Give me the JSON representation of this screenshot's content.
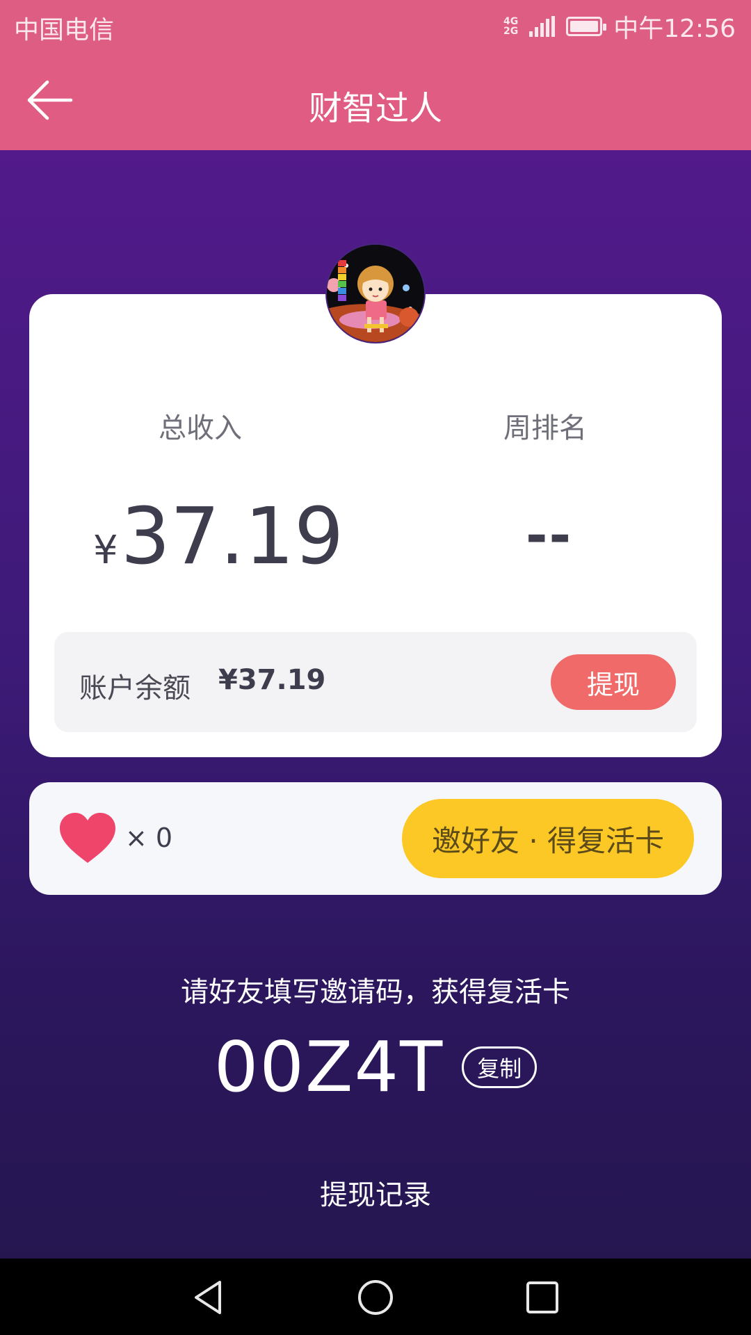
{
  "status_bar": {
    "carrier": "中国电信",
    "network_top": "4G",
    "network_bottom": "2G",
    "time": "中午12:56",
    "icons": [
      "signal-icon",
      "battery-icon"
    ]
  },
  "app_bar": {
    "title": "财智过人",
    "back_icon": "back-arrow-icon"
  },
  "stats": {
    "income_label": "总收入",
    "income_currency": "¥",
    "income_value": "37.19",
    "rank_label": "周排名",
    "rank_value": "--"
  },
  "balance": {
    "label": "账户余额",
    "value": "¥37.19",
    "withdraw_label": "提现"
  },
  "lives": {
    "icon": "heart-icon",
    "count_text": "× 0",
    "invite_button_label": "邀好友 · 得复活卡"
  },
  "invite": {
    "hint": "请好友填写邀请码，获得复活卡",
    "code": "00Z4T",
    "copy_label": "复制"
  },
  "records_link": "提现记录",
  "nav": {
    "icons": [
      "nav-back-icon",
      "nav-home-icon",
      "nav-recents-icon"
    ]
  },
  "colors": {
    "header": "#e05c82",
    "background_top": "#521a8a",
    "background_bottom": "#251650",
    "withdraw_button": "#f06a6a",
    "invite_button": "#fcc825",
    "heart": "#f0456b"
  }
}
